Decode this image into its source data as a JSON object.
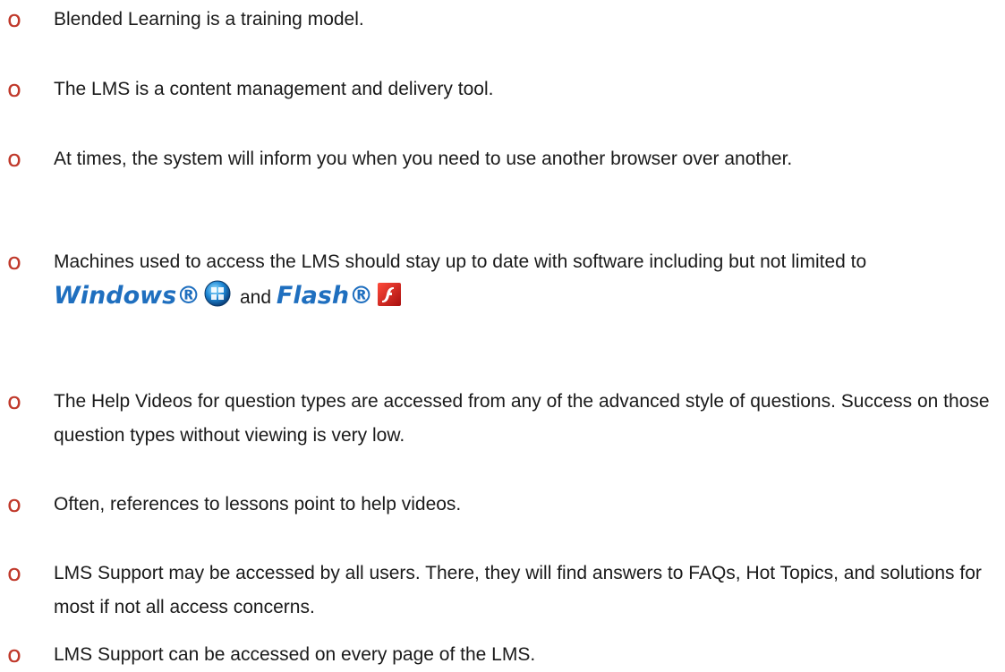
{
  "bullet_glyph": "o",
  "bullet_color": "#c0392b",
  "brand_color": "#1f6fbf",
  "items": [
    "Blended Learning is a training model.",
    "The LMS is a content management and delivery tool.",
    "At times, the system will inform you when you need to use another browser over another.",
    {
      "prefix": "Machines used to access the LMS should stay up to date with software including but not limited to ",
      "brand1": "Windows®",
      "brand1_icon": "windows-logo-icon",
      "connector": " and ",
      "brand2": "Flash®",
      "brand2_icon": "flash-logo-icon"
    },
    "The Help Videos for question types are accessed from any of the advanced style of questions.  Success on those question types without viewing is very low.",
    "Often, references to lessons point to help videos.",
    "LMS Support may be accessed by all users.  There, they will find answers to FAQs, Hot Topics, and solutions for most if not all access concerns.",
    "LMS Support can be accessed on every page of the LMS."
  ]
}
